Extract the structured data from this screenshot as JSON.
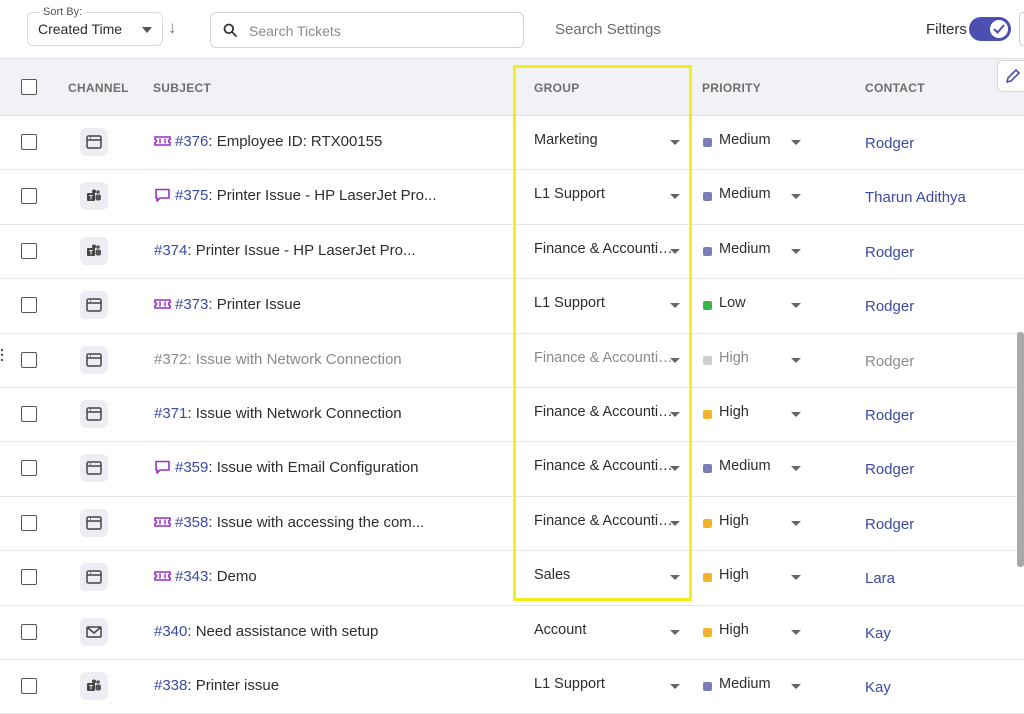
{
  "toolbar": {
    "sort_caption": "Sort By:",
    "sort_value": "Created Time",
    "sort_direction_icon": "arrow-down-icon",
    "search_placeholder": "Search Tickets",
    "search_settings": "Search Settings",
    "filters_label": "Filters",
    "filters_enabled": true
  },
  "table": {
    "columns": {
      "channel": "CHANNEL",
      "subject": "SUBJECT",
      "group": "GROUP",
      "priority": "PRIORITY",
      "contact": "CONTACT"
    },
    "rows": [
      {
        "channel_icon": "web-form-icon",
        "subject_icon": "ticket-icon",
        "id": "#376",
        "subject": ": Employee ID: RTX00155",
        "group": "Marketing",
        "priority": "Medium",
        "priority_color": "#7b7fb8",
        "contact": "Rodger",
        "muted": false
      },
      {
        "channel_icon": "teams-icon",
        "subject_icon": "chat-icon",
        "id": "#375",
        "subject": ": Printer Issue - HP LaserJet Pro...",
        "group": "L1 Support",
        "priority": "Medium",
        "priority_color": "#7b7fb8",
        "contact": "Tharun Adithya",
        "muted": false
      },
      {
        "channel_icon": "teams-icon",
        "subject_icon": "",
        "id": "#374",
        "subject": ": Printer Issue - HP LaserJet Pro...",
        "group": "Finance & Accounting",
        "priority": "Medium",
        "priority_color": "#7b7fb8",
        "contact": "Rodger",
        "muted": false
      },
      {
        "channel_icon": "web-form-icon",
        "subject_icon": "ticket-icon",
        "id": "#373",
        "subject": ": Printer Issue",
        "group": "L1 Support",
        "priority": "Low",
        "priority_color": "#3cb44b",
        "contact": "Rodger",
        "muted": false
      },
      {
        "channel_icon": "web-form-icon",
        "subject_icon": "",
        "id": "#372",
        "subject": ": Issue with Network Connection",
        "group": "Finance & Accounting",
        "priority": "High",
        "priority_color": "#cfcfcf",
        "contact": "Rodger",
        "muted": true
      },
      {
        "channel_icon": "web-form-icon",
        "subject_icon": "",
        "id": "#371",
        "subject": ": Issue with Network Connection",
        "group": "Finance & Accounting",
        "priority": "High",
        "priority_color": "#f5b22c",
        "contact": "Rodger",
        "muted": false
      },
      {
        "channel_icon": "web-form-icon",
        "subject_icon": "chat-icon",
        "id": "#359",
        "subject": ": Issue with Email Configuration",
        "group": "Finance & Accounting",
        "priority": "Medium",
        "priority_color": "#7b7fb8",
        "contact": "Rodger",
        "muted": false
      },
      {
        "channel_icon": "web-form-icon",
        "subject_icon": "ticket-icon",
        "id": "#358",
        "subject": ": Issue with accessing the com...",
        "group": "Finance & Accounting",
        "priority": "High",
        "priority_color": "#f5b22c",
        "contact": "Rodger",
        "muted": false
      },
      {
        "channel_icon": "web-form-icon",
        "subject_icon": "ticket-icon",
        "id": "#343",
        "subject": ": Demo",
        "group": "Sales",
        "priority": "High",
        "priority_color": "#f5b22c",
        "contact": "Lara",
        "muted": false
      },
      {
        "channel_icon": "email-icon",
        "subject_icon": "",
        "id": "#340",
        "subject": ": Need assistance with setup",
        "group": "Account",
        "priority": "High",
        "priority_color": "#f5b22c",
        "contact": "Kay",
        "muted": false
      },
      {
        "channel_icon": "teams-icon",
        "subject_icon": "",
        "id": "#338",
        "subject": ": Printer issue",
        "group": "L1 Support",
        "priority": "Medium",
        "priority_color": "#7b7fb8",
        "contact": "Kay",
        "muted": false
      }
    ]
  },
  "colors": {
    "accent": "#4a4fb0",
    "link": "#3b4aa3",
    "highlight": "#f4ef1c",
    "subject_icon": "#9b2fc9"
  }
}
